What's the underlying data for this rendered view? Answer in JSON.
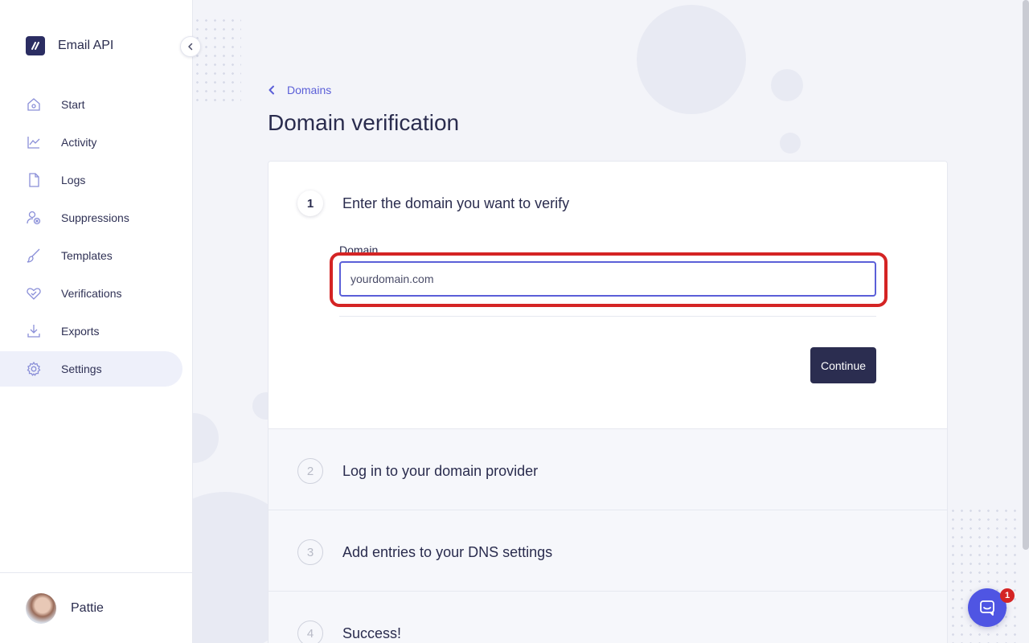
{
  "app": {
    "brand_name": "Email API",
    "collapse_icon": "chevron-left-icon"
  },
  "sidebar": {
    "items": [
      {
        "label": "Start",
        "icon": "home-icon",
        "active": false
      },
      {
        "label": "Activity",
        "icon": "chart-line-icon",
        "active": false
      },
      {
        "label": "Logs",
        "icon": "document-icon",
        "active": false
      },
      {
        "label": "Suppressions",
        "icon": "user-block-icon",
        "active": false
      },
      {
        "label": "Templates",
        "icon": "brush-icon",
        "active": false
      },
      {
        "label": "Verifications",
        "icon": "heart-check-icon",
        "active": false
      },
      {
        "label": "Exports",
        "icon": "download-icon",
        "active": false
      },
      {
        "label": "Settings",
        "icon": "gear-icon",
        "active": true
      }
    ]
  },
  "user": {
    "name": "Pattie"
  },
  "breadcrumb": {
    "label": "Domains"
  },
  "page": {
    "title": "Domain verification"
  },
  "steps": [
    {
      "number": "1",
      "title": "Enter the domain you want to verify",
      "active": true
    },
    {
      "number": "2",
      "title": "Log in to your domain provider",
      "active": false
    },
    {
      "number": "3",
      "title": "Add entries to your DNS settings",
      "active": false
    },
    {
      "number": "4",
      "title": "Success!",
      "active": false
    }
  ],
  "form": {
    "domain_label": "Domain",
    "domain_placeholder": "yourdomain.com",
    "domain_value": "",
    "continue_label": "Continue"
  },
  "chat": {
    "badge_count": "1"
  },
  "colors": {
    "accent": "#5b5fd8",
    "primary_button": "#2b2d50",
    "highlight": "#d42424",
    "chat": "#4f55e3"
  }
}
